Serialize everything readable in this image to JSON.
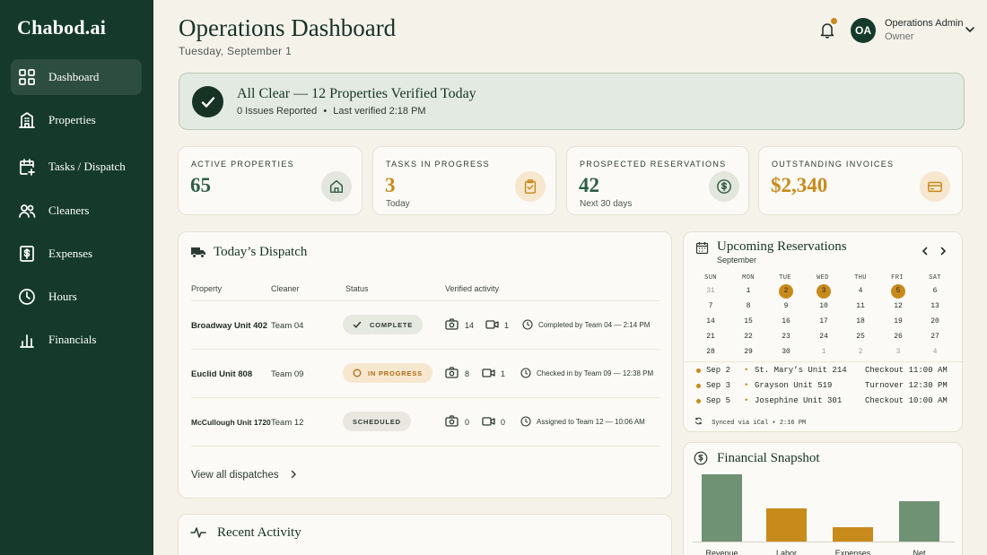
{
  "brand": "Chabod.ai",
  "nav": [
    {
      "label": "Dashboard",
      "icon": "grid-icon",
      "active": true
    },
    {
      "label": "Properties",
      "icon": "building-icon"
    },
    {
      "label": "Tasks / Dispatch",
      "icon": "calendar-plus-icon"
    },
    {
      "label": "Cleaners",
      "icon": "users-icon"
    },
    {
      "label": "Expenses",
      "icon": "receipt-icon"
    },
    {
      "label": "Hours",
      "icon": "clock-icon"
    },
    {
      "label": "Financials",
      "icon": "bar-chart-icon"
    }
  ],
  "header": {
    "title": "Operations Dashboard",
    "date": "Tuesday, September 1",
    "user": {
      "initials": "OA",
      "name": "Operations Admin",
      "role": "Owner"
    }
  },
  "banner": {
    "title": "All Clear — 12 Properties Verified Today",
    "issues": "0 Issues Reported",
    "separator": "•",
    "last_verified": "Last verified 2:18 PM"
  },
  "stats": [
    {
      "label": "ACTIVE PROPERTIES",
      "value": "65",
      "note": "",
      "icon": "house-icon",
      "color": "#2f5e45"
    },
    {
      "label": "TASKS IN PROGRESS",
      "value": "3",
      "note": "Today",
      "icon": "clipboard-check-icon",
      "color": "#c98a1c"
    },
    {
      "label": "PROSPECTED RESERVATIONS",
      "value": "42",
      "note": "Next 30 days",
      "icon": "dollar-circle-icon",
      "color": "#2f5e45"
    },
    {
      "label": "OUTSTANDING INVOICES",
      "value": "$2,340",
      "note": "",
      "icon": "credit-card-icon",
      "color": "#c98a1c"
    }
  ],
  "dispatch": {
    "title": "Today’s Dispatch",
    "columns": [
      "Property",
      "Cleaner",
      "Status",
      "Verified activity"
    ],
    "rows": [
      {
        "property": "Broadway Unit 402",
        "cleaner": "Team 04",
        "status": "COMPLETE",
        "photos": "14",
        "videos": "1",
        "note": "Completed by Team 04 — 2:14 PM"
      },
      {
        "property": "Euclid Unit 808",
        "cleaner": "Team 09",
        "status": "IN PROGRESS",
        "photos": "8",
        "videos": "1",
        "note": "Checked in by Team 09 — 12:38 PM"
      },
      {
        "property": "McCullough Unit 1720",
        "cleaner": "Team 12",
        "status": "SCHEDULED",
        "photos": "0",
        "videos": "0",
        "note": "Assigned to Team 12 — 10:06 AM"
      }
    ],
    "view_all": "View all dispatches"
  },
  "reservations": {
    "title": "Upcoming Reservations",
    "month": "September",
    "dow": [
      "SUN",
      "MON",
      "TUE",
      "WED",
      "THU",
      "FRI",
      "SAT"
    ],
    "weeks": [
      [
        "31",
        "1",
        "2",
        "3",
        "4",
        "5",
        "6"
      ],
      [
        "7",
        "8",
        "9",
        "10",
        "11",
        "12",
        "13"
      ],
      [
        "14",
        "15",
        "16",
        "17",
        "18",
        "19",
        "20"
      ],
      [
        "21",
        "22",
        "23",
        "24",
        "25",
        "26",
        "27"
      ],
      [
        "28",
        "29",
        "30",
        "1",
        "2",
        "3",
        "4"
      ]
    ],
    "highlighted": [
      "2",
      "3",
      "5"
    ],
    "items": [
      {
        "date": "Sep 2",
        "unit": "St. Mary’s Unit 214",
        "event": "Checkout 11:00 AM"
      },
      {
        "date": "Sep 3",
        "unit": "Grayson Unit 519",
        "event": "Turnover 12:30 PM"
      },
      {
        "date": "Sep 5",
        "unit": "Josephine Unit 301",
        "event": "Checkout 10:00 AM"
      }
    ],
    "synced": "Synced via iCal • 2:16 PM"
  },
  "financial": {
    "title": "Financial Snapshot",
    "chart_data": {
      "type": "bar",
      "categories": [
        "Revenue",
        "Labor",
        "Expenses",
        "Net"
      ],
      "values": [
        100,
        49,
        22,
        60
      ],
      "colors": [
        "#6f9274",
        "#c98a1c",
        "#c98a1c",
        "#6f9274"
      ]
    }
  },
  "activity": {
    "title": "Recent Activity"
  }
}
